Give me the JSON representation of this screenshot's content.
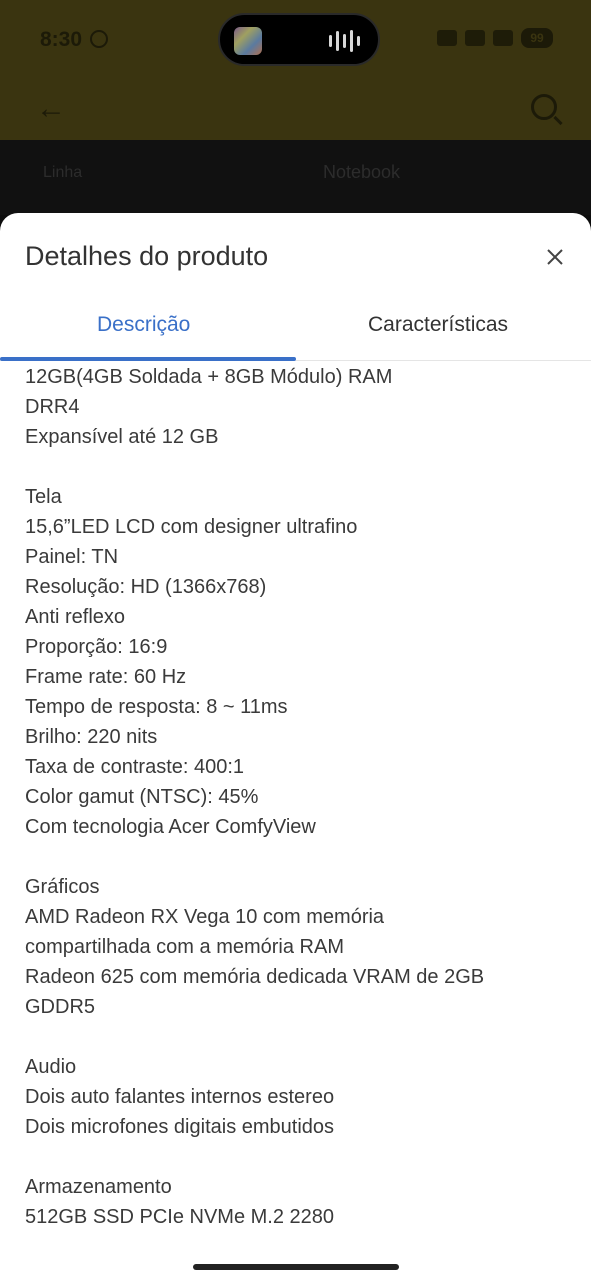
{
  "status_bar": {
    "time": "8:30",
    "battery": "99"
  },
  "background": {
    "spec_label": "Linha",
    "spec_value": "Notebook"
  },
  "sheet": {
    "title": "Detalhes do produto",
    "tabs": [
      {
        "label": "Descrição",
        "active": true
      },
      {
        "label": "Características",
        "active": false
      }
    ]
  },
  "description": {
    "memory": [
      "12GB(4GB Soldada + 8GB Módulo) RAM",
      "DRR4",
      "Expansível até 12 GB"
    ],
    "screen": [
      "Tela",
      "15,6”LED LCD com designer ultrafino",
      "Painel: TN",
      "Resolução: HD (1366x768)",
      "Anti reflexo",
      "Proporção: 16:9",
      "Frame rate: 60 Hz",
      "Tempo de resposta: 8 ~ 11ms",
      "Brilho: 220 nits",
      "Taxa de contraste: 400:1",
      "Color gamut (NTSC): 45%",
      "Com tecnologia Acer ComfyView"
    ],
    "graphics": [
      "Gráficos",
      "AMD Radeon RX Vega 10 com memória",
      "compartilhada com a memória RAM",
      "Radeon 625 com memória dedicada VRAM de 2GB",
      "GDDR5"
    ],
    "audio": [
      "Audio",
      "Dois auto falantes internos estereo",
      "Dois microfones digitais embutidos"
    ],
    "storage": [
      "Armazenamento",
      "512GB SSD PCIe NVMe M.2 2280"
    ]
  },
  "colors": {
    "accent": "#3a70c8",
    "text": "#3a3a3a",
    "overlay_bg": "#3a3410"
  }
}
